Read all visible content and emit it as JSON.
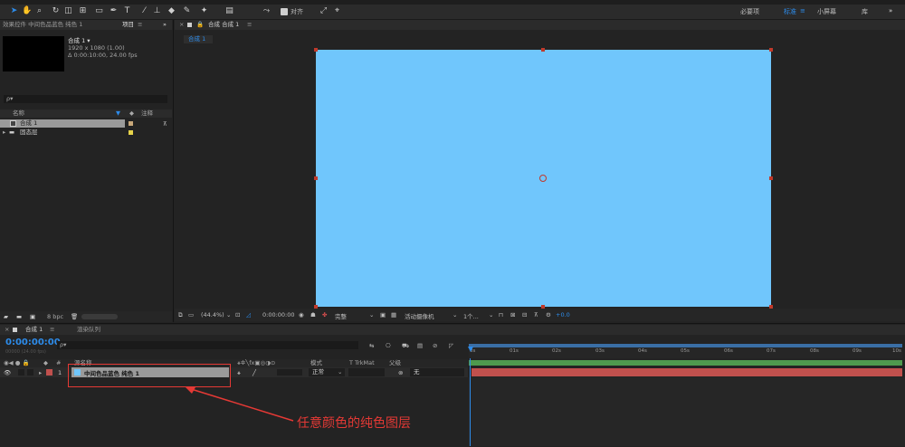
{
  "toolbar": {
    "snap_label": "对齐",
    "workspaces": [
      "必要项",
      "标准",
      "小屏幕",
      "库"
    ],
    "active_workspace": "标准",
    "more": "»"
  },
  "left_panel": {
    "tab_effects": "效果控件 中间色品蓝色 纯色 1",
    "tab_project": "项目",
    "menu_glyph": "≡",
    "expand": "»",
    "comp_name": "合成 1 ▾",
    "comp_size": "1920 x 1080 (1.00)",
    "comp_duration": "Δ 0:00:10:00, 24.00 fps",
    "search_placeholder": "ρ▾",
    "col_name": "名称",
    "col_comment": "注释",
    "items": [
      {
        "label": "合成 1",
        "color": "#c8a87a"
      },
      {
        "label": "固态层",
        "color": "#e6d34a"
      }
    ],
    "bpc": "8 bpc"
  },
  "comp_panel": {
    "tab_label": "合成 合成 1",
    "menu_glyph": "≡",
    "breadcrumb": "合成 1",
    "frame_color": "#70c6fc",
    "zoom": "(44.4%)",
    "timecode": "0:00:00:00",
    "quality": "完整",
    "camera": "活动摄像机",
    "views": "1个...",
    "exposure": "+0.0"
  },
  "timeline": {
    "tab_comp": "合成 1",
    "menu_glyph": "≡",
    "tab_render": "渲染队列",
    "timecode": "0:00:00:00",
    "fps_info": "00000 (24.00 fps)",
    "search_placeholder": "ρ▾",
    "col_source": "源名称",
    "col_mode": "模式",
    "col_trkmat": "T TrkMat",
    "col_parent": "父级",
    "layer_index": "1",
    "layer_name": "中间色品蓝色 纯色 1",
    "layer_mode": "正常",
    "layer_parent": "无",
    "ruler": [
      "0s",
      "01s",
      "02s",
      "03s",
      "04s",
      "05s",
      "06s",
      "07s",
      "08s",
      "09s",
      "10s"
    ],
    "layer_bar_color": "#c0504d",
    "work_area_color": "#3a6ea5"
  },
  "annotation": {
    "text": "任意颜色的纯色图层"
  }
}
